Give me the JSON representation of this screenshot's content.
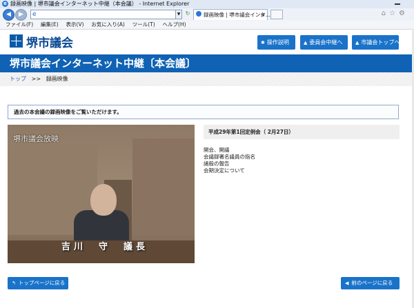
{
  "browser": {
    "window_title": "録画映像 | 堺市議会インターネット中継（本会議） - Internet Explorer",
    "tab_label": "録画映像 | 堺市議会インタ...",
    "menu": [
      "ファイル(F)",
      "編集(E)",
      "表示(V)",
      "お気に入り(A)",
      "ツール(T)",
      "ヘルプ(H)"
    ]
  },
  "site": {
    "logo_text": "堺市議会",
    "header_buttons": [
      {
        "label": "操作説明",
        "icon": "gear-icon"
      },
      {
        "label": "委員会中継へ",
        "icon": "triangle-icon"
      },
      {
        "label": "市議会トップへ",
        "icon": "triangle-icon"
      }
    ],
    "banner_title": "堺市議会インターネット中継〔本会議〕"
  },
  "breadcrumb": {
    "home": "トップ",
    "separator": ">>",
    "current": "録画映像"
  },
  "notice": "過去の本会議の録画映像をご覧いただけます。",
  "video": {
    "watermark": "堺市議会放映",
    "caption": "吉川　守　議長"
  },
  "session_title": "平成29年第1回定例会（ 2月27日）",
  "agenda": [
    "開会、開議",
    "会議録署名議員の指名",
    "諸般の報告",
    "会期決定について"
  ],
  "footer": {
    "top_button": "トップページに戻る",
    "back_button": "前のページに戻る"
  },
  "colors": {
    "brand_blue": "#0f62b4",
    "button_blue": "#1a73c9"
  }
}
